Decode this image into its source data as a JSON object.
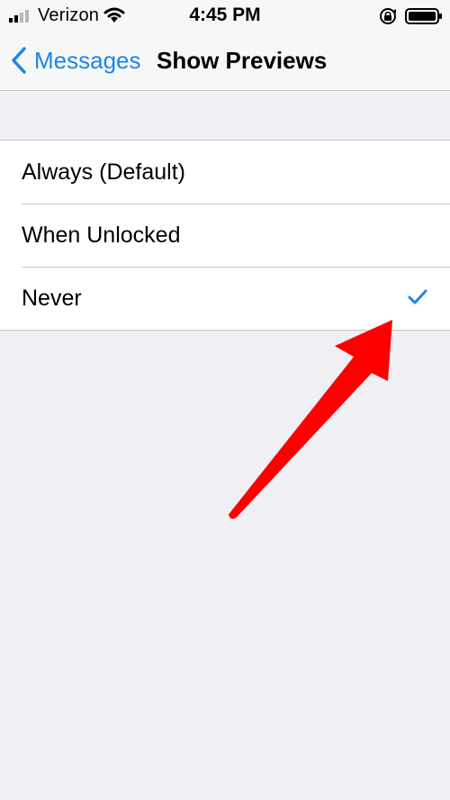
{
  "status_bar": {
    "carrier": "Verizon",
    "time": "4:45 PM",
    "icons": [
      "cellular-signal-icon",
      "wifi-icon",
      "rotation-lock-icon",
      "battery-icon"
    ]
  },
  "nav": {
    "back_label": "Messages",
    "title": "Show Previews"
  },
  "options": [
    {
      "label": "Always (Default)",
      "selected": false
    },
    {
      "label": "When Unlocked",
      "selected": false
    },
    {
      "label": "Never",
      "selected": true
    }
  ],
  "colors": {
    "accent": "#1a86ea",
    "background": "#efeff4",
    "annotation_arrow": "#ff0000"
  }
}
